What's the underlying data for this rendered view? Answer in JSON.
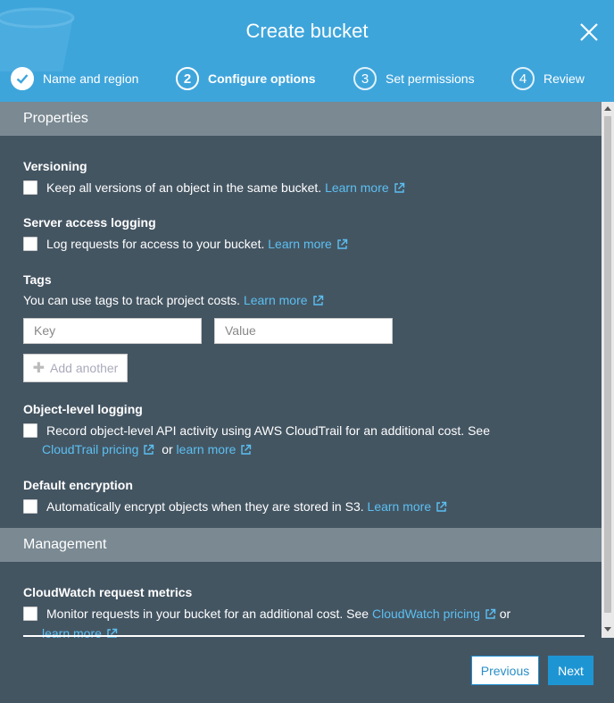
{
  "colors": {
    "header": "#3ea5db",
    "body": "#445562",
    "section_bar": "#7a8992",
    "link": "#5bc0f2",
    "primary": "#1e95d3"
  },
  "dialog": {
    "title": "Create bucket",
    "close_icon": "close-icon"
  },
  "steps": [
    {
      "number": "",
      "label": "Name and region",
      "state": "done",
      "icon": "checkmark-icon"
    },
    {
      "number": "2",
      "label": "Configure options",
      "state": "active"
    },
    {
      "number": "3",
      "label": "Set permissions",
      "state": "inactive"
    },
    {
      "number": "4",
      "label": "Review",
      "state": "inactive"
    }
  ],
  "sections": {
    "properties": "Properties",
    "management": "Management"
  },
  "versioning": {
    "title": "Versioning",
    "text": "Keep all versions of an object in the same bucket.",
    "link": "Learn more"
  },
  "server_logging": {
    "title": "Server access logging",
    "text": "Log requests for access to your bucket.",
    "link": "Learn more"
  },
  "tags": {
    "title": "Tags",
    "text": "You can use tags to track project costs.",
    "link": "Learn more",
    "key_placeholder": "Key",
    "value_placeholder": "Value",
    "add_label": "Add another"
  },
  "object_logging": {
    "title": "Object-level logging",
    "text": "Record object-level API activity using AWS CloudTrail for an additional cost. See",
    "link1": "CloudTrail pricing",
    "or": "or",
    "link2": "learn more"
  },
  "encryption": {
    "title": "Default encryption",
    "text": "Automatically encrypt objects when they are stored in S3.",
    "link": "Learn more"
  },
  "cloudwatch": {
    "title": "CloudWatch request metrics",
    "text": "Monitor requests in your bucket for an additional cost. See",
    "link1": "CloudWatch pricing",
    "or": "or",
    "link2": "learn more"
  },
  "footer": {
    "previous": "Previous",
    "next": "Next"
  }
}
